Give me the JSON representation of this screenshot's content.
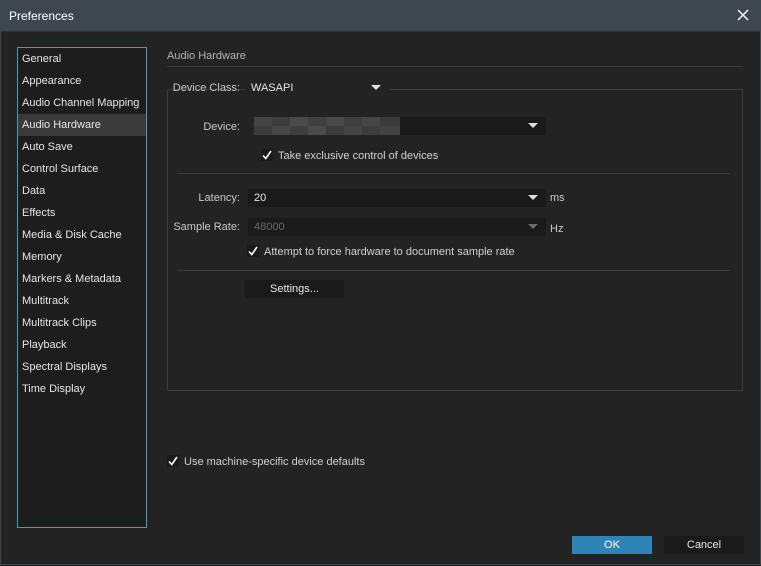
{
  "window": {
    "title": "Preferences"
  },
  "sidebar": {
    "items": [
      {
        "label": "General"
      },
      {
        "label": "Appearance"
      },
      {
        "label": "Audio Channel Mapping"
      },
      {
        "label": "Audio Hardware"
      },
      {
        "label": "Auto Save"
      },
      {
        "label": "Control Surface"
      },
      {
        "label": "Data"
      },
      {
        "label": "Effects"
      },
      {
        "label": "Media & Disk Cache"
      },
      {
        "label": "Memory"
      },
      {
        "label": "Markers & Metadata"
      },
      {
        "label": "Multitrack"
      },
      {
        "label": "Multitrack Clips"
      },
      {
        "label": "Playback"
      },
      {
        "label": "Spectral Displays"
      },
      {
        "label": "Time Display"
      }
    ],
    "selected": "Audio Hardware"
  },
  "section": {
    "title": "Audio Hardware"
  },
  "device_class": {
    "label": "Device Class:",
    "value": "WASAPI"
  },
  "device": {
    "label": "Device:",
    "value": ""
  },
  "exclusive": {
    "label": "Take exclusive control of devices",
    "checked": true
  },
  "latency": {
    "label": "Latency:",
    "value": "20",
    "unit": "ms"
  },
  "sample_rate": {
    "label": "Sample Rate:",
    "value": "48000",
    "unit": "Hz",
    "disabled": true
  },
  "force_rate": {
    "label": "Attempt to force hardware to document sample rate",
    "checked": true
  },
  "settings_button": {
    "label": "Settings..."
  },
  "machine_defaults": {
    "label": "Use machine-specific device defaults",
    "checked": true
  },
  "footer": {
    "ok_label": "OK",
    "cancel_label": "Cancel"
  },
  "colors": {
    "accent": "#2e84b4",
    "sidebar_border": "#3ea0c8",
    "background": "#232323"
  }
}
